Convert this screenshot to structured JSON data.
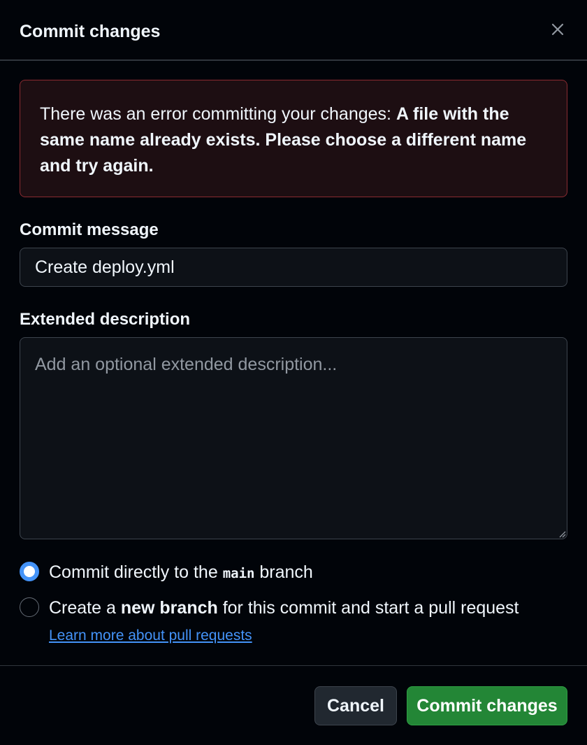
{
  "dialog": {
    "title": "Commit changes",
    "close_icon": "close-icon"
  },
  "error": {
    "prefix": "There was an error committing your changes: ",
    "message": "A file with the same name already exists. Please choose a different name and try again."
  },
  "commit_message": {
    "label": "Commit message",
    "value": "Create deploy.yml"
  },
  "extended_description": {
    "label": "Extended description",
    "placeholder": "Add an optional extended description..."
  },
  "branch_options": {
    "direct": {
      "text_before": "Commit directly to the ",
      "branch_name": "main",
      "text_after": " branch",
      "checked": true
    },
    "new_branch": {
      "text_before": "Create a ",
      "bold_text": "new branch",
      "text_after": " for this commit and start a pull request ",
      "link_text": "Learn more about pull requests",
      "checked": false
    }
  },
  "buttons": {
    "cancel": "Cancel",
    "commit": "Commit changes"
  },
  "colors": {
    "background": "#010409",
    "accent": "#4493f8",
    "error_border": "#8b2b31",
    "error_bg": "#1d0e12",
    "primary_button": "#238636"
  }
}
